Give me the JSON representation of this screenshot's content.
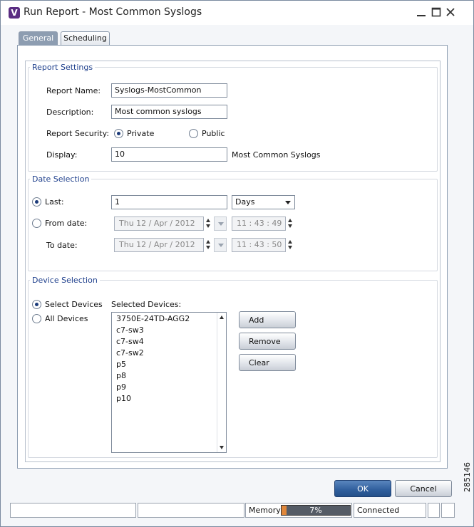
{
  "window": {
    "logo": "V",
    "title": "Run Report - Most Common Syslogs"
  },
  "tabs": [
    {
      "label": "General",
      "active": true
    },
    {
      "label": "Scheduling",
      "active": false
    }
  ],
  "report_settings": {
    "group_label": "Report Settings",
    "name_label": "Report Name:",
    "name_value": "Syslogs-MostCommon",
    "description_label": "Description:",
    "description_value": "Most common syslogs",
    "security_label": "Report Security:",
    "security_options": [
      "Private",
      "Public"
    ],
    "security_selected": "Private",
    "display_label": "Display:",
    "display_value": "10",
    "display_suffix": "Most Common Syslogs"
  },
  "date_selection": {
    "group_label": "Date Selection",
    "last_label": "Last:",
    "last_value": "1",
    "unit_value": "Days",
    "from_label": "From date:",
    "from_date": "Thu 12  /  Apr  /  2012",
    "from_time": "11  :  43  :  49",
    "to_label": "To date:",
    "to_date": "Thu 12  /  Apr  /  2012",
    "to_time": "11  :  43  :  50",
    "selected": "Last"
  },
  "device_selection": {
    "group_label": "Device Selection",
    "select_devices_label": "Select Devices",
    "all_devices_label": "All Devices",
    "selected_mode": "Select Devices",
    "selected_devices_label": "Selected Devices:",
    "devices": [
      "3750E-24TD-AGG2",
      "c7-sw3",
      "c7-sw4",
      "c7-sw2",
      "p5",
      "p8",
      "p9",
      "p10"
    ],
    "add_label": "Add",
    "remove_label": "Remove",
    "clear_label": "Clear"
  },
  "footer": {
    "ok_label": "OK",
    "cancel_label": "Cancel"
  },
  "status_bar": {
    "memory_label": "Memory:",
    "memory_percent": 7,
    "memory_text": "7%",
    "connection": "Connected"
  },
  "figure_number": "285146",
  "colors": {
    "accent": "#2f5e9c",
    "group_label": "#1e3f8c",
    "tab_active": "#8d9db1",
    "memory_fill": "#e0873a"
  }
}
